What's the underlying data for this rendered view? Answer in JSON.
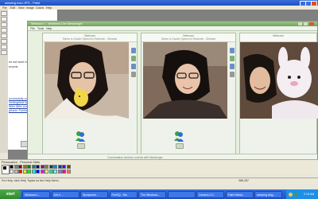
{
  "paint": {
    "title": "wwwing.msn.JPG - Paint",
    "menu": [
      "File",
      "Edit",
      "View",
      "Image",
      "Colors",
      "Help"
    ],
    "canvas_text": [
      {
        "text": "es not work because for a",
        "link": false
      },
      {
        "text": "ecords",
        "link": false
      },
      {
        "text": "uccessfully completed Wi",
        "link": true
      },
      {
        "text": "Setting/fold Wire",
        "link": true
      },
      {
        "text": "Wire Wire.com/fromchasing",
        "link": true
      },
      {
        "text": "phone. Foreword to",
        "link": true
      }
    ],
    "palette_label": "Personalize - Personal Skills",
    "palette_colors": [
      "#000000",
      "#808080",
      "#800000",
      "#808000",
      "#008000",
      "#008080",
      "#000080",
      "#800080",
      "#808040",
      "#004040",
      "#0080ff",
      "#004080",
      "#4000ff",
      "#804000",
      "#ffffff",
      "#c0c0c0",
      "#ff0000",
      "#ffff00",
      "#00ff00",
      "#00ffff",
      "#0000ff",
      "#ff00ff",
      "#ffff80",
      "#00ff80",
      "#80ffff",
      "#8080ff",
      "#ff0080",
      "#ff8040"
    ],
    "status_help": "For Help, click Help Topics on the Help Menu.",
    "status_coords": "386,287"
  },
  "messenger": {
    "title": "Webcam 1 - Windows Live Messenger",
    "menu": [
      "File",
      "Tools",
      "Help"
    ],
    "panels": [
      {
        "title": "Webcam",
        "subtitle": "Stereo is Gooder Speech is Reckoner - Streame"
      },
      {
        "title": "Webcam",
        "subtitle": "Stereo is Gooder Speech is Reckoner - Streame"
      },
      {
        "title": "Webcam",
        "subtitle": ""
      }
    ],
    "status": "Conversation window controls with Messenger"
  },
  "taskbar": {
    "start_label": "start",
    "tasks": [
      "Windows L...",
      "Ant 4 ...",
      "Sprayonne...",
      "FireSQ - Ma",
      "The Windows...",
      "",
      "Camera 2.0...",
      "Paint Windo...",
      "weeping sing..."
    ],
    "clock": "2:19 AM"
  },
  "icons": {
    "start": "windows-logo-icon",
    "buddy": "msn-buddy-icon",
    "tool": "paint-tool-icon",
    "minimize": "minimize-icon",
    "maximize": "maximize-icon",
    "close": "close-icon"
  },
  "colors": {
    "xp_blue": "#2251c2",
    "messenger_green": "#73a25e",
    "start_green": "#2f8a2c"
  }
}
